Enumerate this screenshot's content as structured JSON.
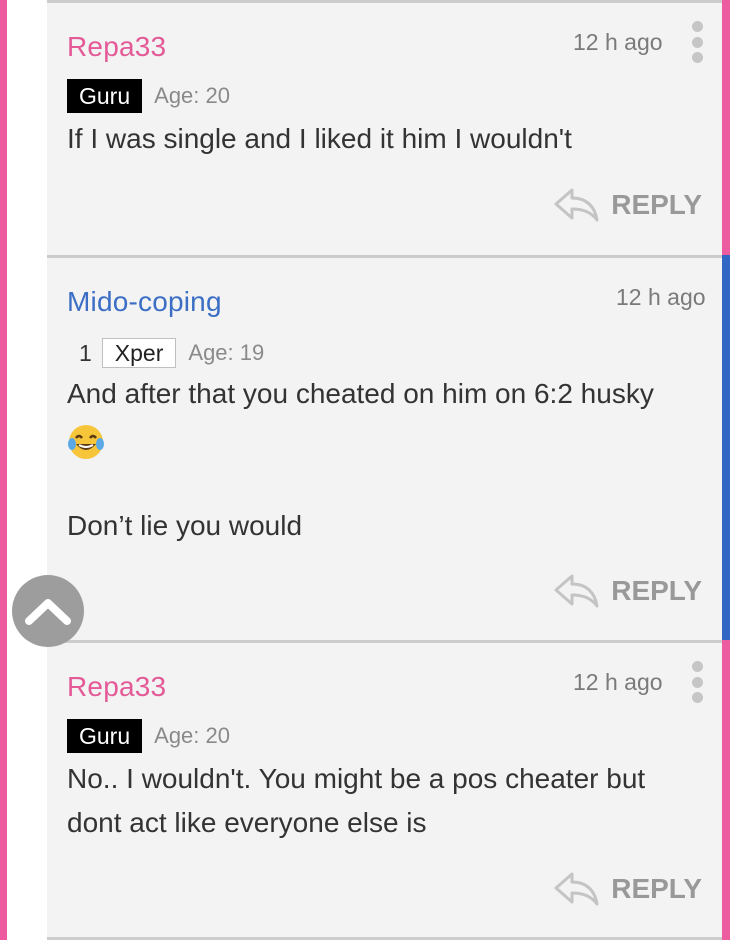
{
  "colors": {
    "left_accent": "#ec5c9f",
    "pink_accent": "#ec5c9f",
    "blue_accent": "#3166c4",
    "pink_name": "#e35a97",
    "blue_name": "#3b6ec4"
  },
  "comments": [
    {
      "username": "Repa33",
      "time": "12 h ago",
      "badge": "Guru",
      "age": "Age: 20",
      "text_lines": [
        "If I was single and I liked it him I wouldn't"
      ],
      "reply_label": "REPLY",
      "menu_icon": "kebab-menu-icon"
    },
    {
      "username": "Mido-coping",
      "time": "12 h ago",
      "rank": "1",
      "badge": "Xper",
      "age": "Age: 19",
      "text_lines": [
        "And after that you cheated on him on 6:2 husky",
        "Don’t lie you would"
      ],
      "emoji": "face-with-tears-of-joy-emoji",
      "reply_label": "REPLY"
    },
    {
      "username": "Repa33",
      "time": "12 h ago",
      "badge": "Guru",
      "age": "Age: 20",
      "text_lines": [
        "No.. I wouldn't. You might be a pos cheater but",
        "dont act like everyone else is"
      ],
      "reply_label": "REPLY",
      "menu_icon": "kebab-menu-icon"
    }
  ],
  "scroll_top_icon": "chevron-up-icon"
}
